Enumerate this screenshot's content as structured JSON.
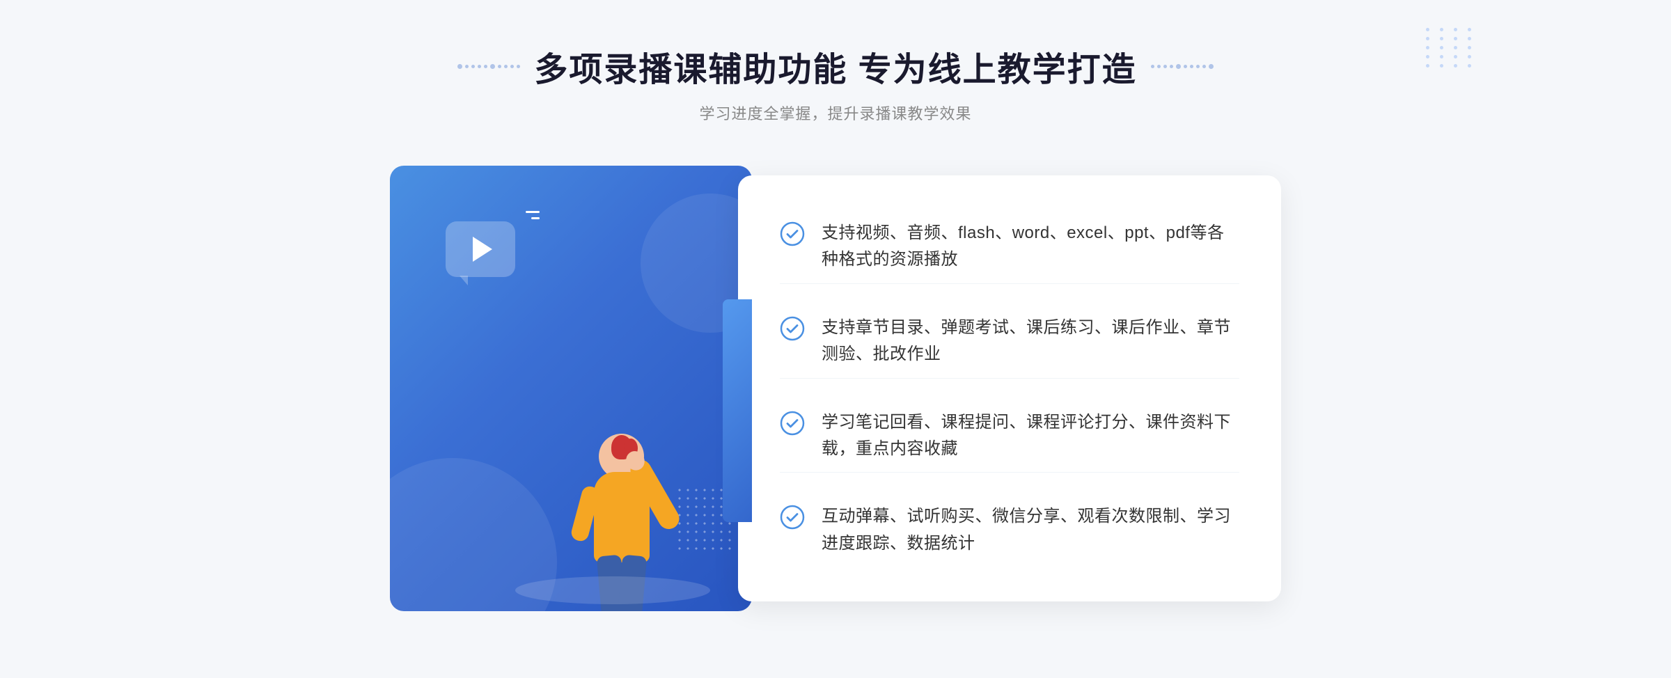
{
  "header": {
    "title": "多项录播课辅助功能 专为线上教学打造",
    "subtitle": "学习进度全掌握，提升录播课教学效果",
    "decorator_left": "❖",
    "decorator_right": "❖"
  },
  "features": [
    {
      "id": 1,
      "text": "支持视频、音频、flash、word、excel、ppt、pdf等各种格式的资源播放"
    },
    {
      "id": 2,
      "text": "支持章节目录、弹题考试、课后练习、课后作业、章节测验、批改作业"
    },
    {
      "id": 3,
      "text": "学习笔记回看、课程提问、课程评论打分、课件资料下载，重点内容收藏"
    },
    {
      "id": 4,
      "text": "互动弹幕、试听购买、微信分享、观看次数限制、学习进度跟踪、数据统计"
    }
  ],
  "colors": {
    "primary": "#4a90e2",
    "title": "#1a1a2e",
    "subtitle": "#888888",
    "feature_text": "#333333",
    "check_color": "#4a90e2",
    "card_gradient_start": "#5599ee",
    "card_gradient_end": "#2855c0"
  }
}
